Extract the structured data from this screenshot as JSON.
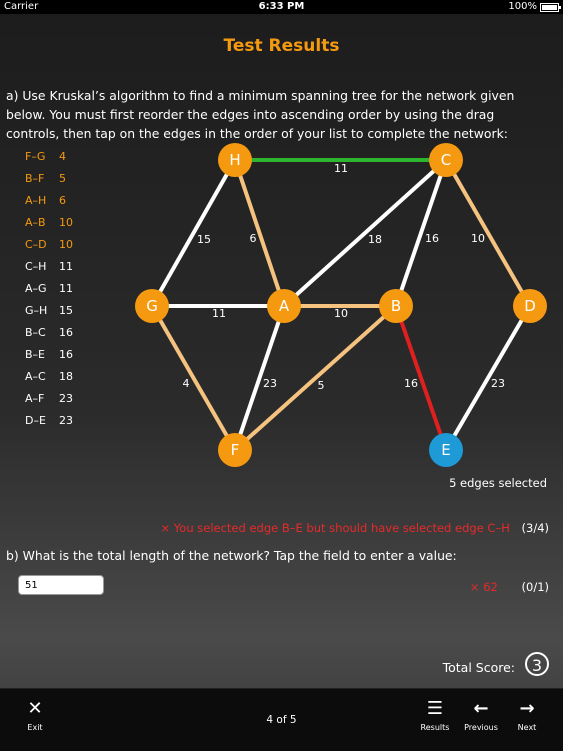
{
  "status": {
    "carrier": "Carrier",
    "time": "6:33 PM",
    "battery": "100%",
    "battery_level": 1.0
  },
  "title": "Test Results",
  "question_a": "a) Use Kruskal’s algorithm to find a minimum spanning tree for the network given below. You must first reorder the edges into ascending order by using the drag controls, then tap on the edges in the order of your list to complete the network:",
  "edges": [
    {
      "name": "F–G",
      "weight": "4",
      "color": "#f59a10"
    },
    {
      "name": "B–F",
      "weight": "5",
      "color": "#f59a10"
    },
    {
      "name": "A–H",
      "weight": "6",
      "color": "#f59a10"
    },
    {
      "name": "A–B",
      "weight": "10",
      "color": "#f59a10"
    },
    {
      "name": "C–D",
      "weight": "10",
      "color": "#f59a10"
    },
    {
      "name": "C–H",
      "weight": "11",
      "color": "#ffffff"
    },
    {
      "name": "A–G",
      "weight": "11",
      "color": "#ffffff"
    },
    {
      "name": "G–H",
      "weight": "15",
      "color": "#ffffff"
    },
    {
      "name": "B–C",
      "weight": "16",
      "color": "#ffffff"
    },
    {
      "name": "B–E",
      "weight": "16",
      "color": "#ffffff"
    },
    {
      "name": "A–C",
      "weight": "18",
      "color": "#ffffff"
    },
    {
      "name": "A–F",
      "weight": "23",
      "color": "#ffffff"
    },
    {
      "name": "D–E",
      "weight": "23",
      "color": "#ffffff"
    }
  ],
  "network": {
    "nodes": [
      {
        "id": "H",
        "color": "#f59a10"
      },
      {
        "id": "C",
        "color": "#f59a10"
      },
      {
        "id": "G",
        "color": "#f59a10"
      },
      {
        "id": "A",
        "color": "#f59a10"
      },
      {
        "id": "B",
        "color": "#f59a10"
      },
      {
        "id": "D",
        "color": "#f59a10"
      },
      {
        "id": "F",
        "color": "#f59a10"
      },
      {
        "id": "E",
        "color": "#1e9ad6"
      }
    ],
    "links": [
      {
        "a": "H",
        "b": "C",
        "weight": "11",
        "color": "#2db52d"
      },
      {
        "a": "H",
        "b": "G",
        "weight": "15",
        "color": "#ffffff"
      },
      {
        "a": "H",
        "b": "A",
        "weight": "6",
        "color": "#f5c27f"
      },
      {
        "a": "C",
        "b": "A",
        "weight": "18",
        "color": "#ffffff"
      },
      {
        "a": "C",
        "b": "B",
        "weight": "16",
        "color": "#ffffff"
      },
      {
        "a": "C",
        "b": "D",
        "weight": "10",
        "color": "#f5c27f"
      },
      {
        "a": "G",
        "b": "A",
        "weight": "11",
        "color": "#ffffff"
      },
      {
        "a": "A",
        "b": "B",
        "weight": "10",
        "color": "#f5c27f"
      },
      {
        "a": "G",
        "b": "F",
        "weight": "4",
        "color": "#f5c27f"
      },
      {
        "a": "A",
        "b": "F",
        "weight": "23",
        "color": "#ffffff"
      },
      {
        "a": "B",
        "b": "F",
        "weight": "5",
        "color": "#f5c27f"
      },
      {
        "a": "B",
        "b": "E",
        "weight": "16",
        "color": "#e01f1f"
      },
      {
        "a": "D",
        "b": "E",
        "weight": "23",
        "color": "#ffffff"
      }
    ]
  },
  "edges_selected": "5 edges selected",
  "feedback_a": {
    "message": "× You selected edge B–E but should have selected edge C–H",
    "score": "(3/4)"
  },
  "question_b": "b) What is the total length of the network? Tap the field to enter a value:",
  "answer": {
    "value": "51"
  },
  "feedback_b": {
    "correct": "× 62",
    "score": "(0/1)"
  },
  "total_label": "Total  Score:",
  "total_score": "3",
  "toolbar": {
    "exit": "Exit",
    "pager": "4 of 5",
    "results": "Results",
    "previous": "Previous",
    "next": "Next"
  }
}
